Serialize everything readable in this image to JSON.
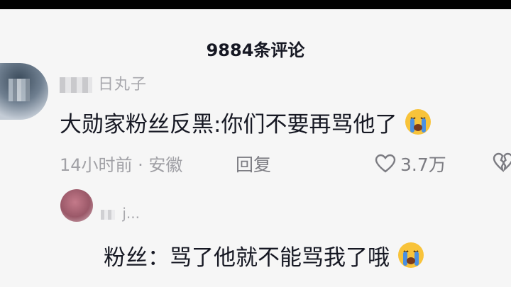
{
  "header": {
    "count_title": "9884条评论"
  },
  "comments": [
    {
      "author": "日丸子",
      "text": "大勋家粉丝反黑:你们不要再骂他了",
      "emoji": "loudly-crying-face-icon",
      "time_location": "14小时前 · 安徽",
      "reply_label": "回复",
      "likes": "3.7万"
    },
    {
      "author": "j...",
      "text": "粉丝：骂了他就不能骂我了哦",
      "emoji": "loudly-crying-face-icon"
    }
  ],
  "colors": {
    "background": "#f6f6f6",
    "primary_text": "#161823",
    "secondary_text": "#a1a1a6",
    "emoji_blue": "#4a90e2",
    "emoji_yellow": "#f8c33a"
  }
}
